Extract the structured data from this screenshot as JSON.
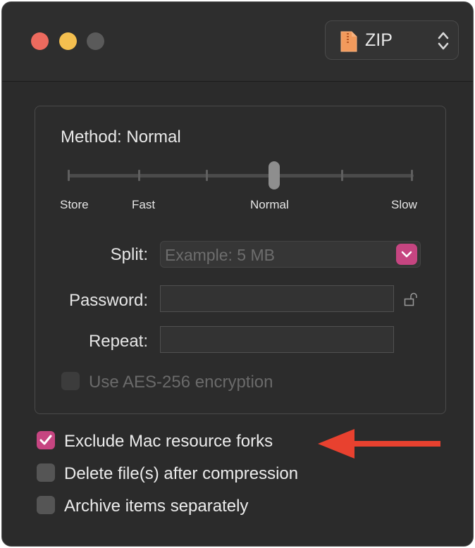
{
  "titlebar": {
    "format": {
      "label": "ZIP"
    }
  },
  "method": {
    "label": "Method: Normal",
    "level_index": 3,
    "level_count": 6,
    "tick_labels": [
      "Store",
      "Fast",
      "Normal",
      "Slow"
    ]
  },
  "split": {
    "label": "Split:",
    "placeholder": "Example: 5 MB"
  },
  "password": {
    "label": "Password:",
    "value": ""
  },
  "repeat": {
    "label": "Repeat:",
    "value": ""
  },
  "aes": {
    "label": "Use AES-256 encryption",
    "checked": false,
    "enabled": false
  },
  "options": [
    {
      "label": "Exclude Mac resource forks",
      "checked": true
    },
    {
      "label": "Delete file(s) after compression",
      "checked": false
    },
    {
      "label": "Archive items separately",
      "checked": false
    }
  ],
  "colors": {
    "accent": "#c64581",
    "annotation_arrow": "#e8412f"
  }
}
